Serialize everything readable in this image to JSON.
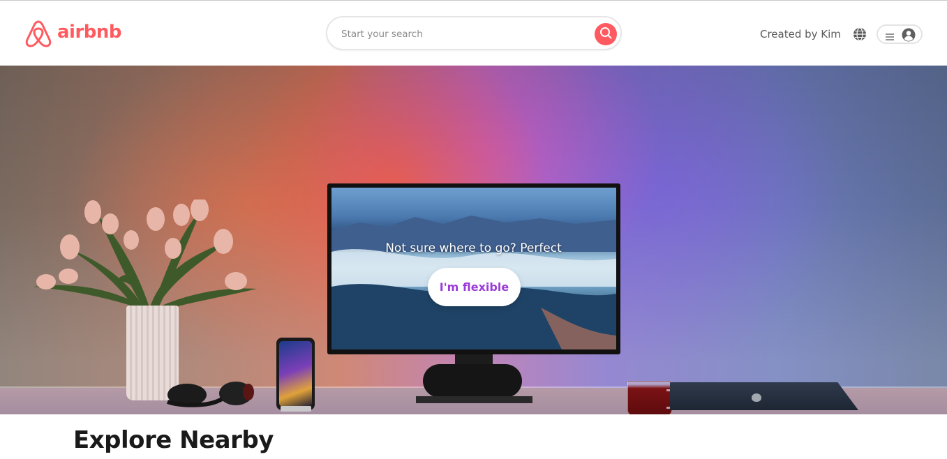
{
  "header": {
    "logo_text": "airbnb",
    "search": {
      "placeholder": "Start your search"
    },
    "created_by": "Created by Kim"
  },
  "hero": {
    "tagline": "Not sure where to go? Perfect",
    "cta_label": "I'm flexible"
  },
  "section": {
    "title": "Explore Nearby"
  },
  "icons": {
    "logo": "airbnb-logo-icon",
    "search": "search-icon",
    "globe": "globe-icon",
    "menu": "menu-icon",
    "avatar": "user-avatar-icon"
  },
  "colors": {
    "brand": "#ff5a5f",
    "cta_text": "#9b3bd8",
    "heading": "#1a1a1a",
    "muted_text": "#5a5a5a"
  }
}
